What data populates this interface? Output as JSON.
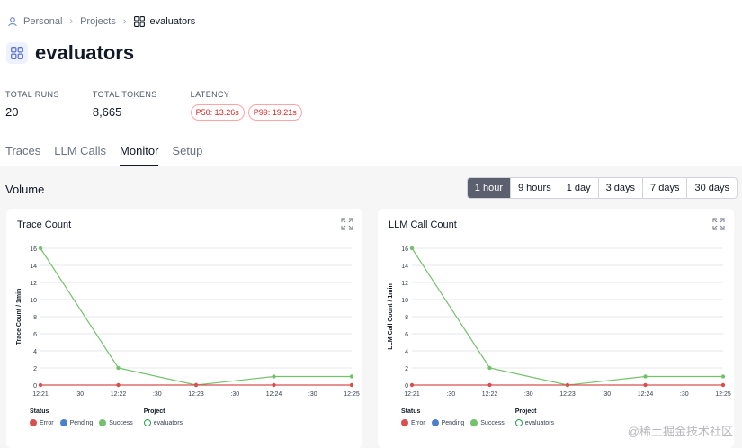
{
  "breadcrumb": {
    "personal": "Personal",
    "projects": "Projects",
    "current": "evaluators"
  },
  "page": {
    "title": "evaluators"
  },
  "stats": {
    "total_runs_label": "TOTAL RUNS",
    "total_runs": "20",
    "total_tokens_label": "TOTAL TOKENS",
    "total_tokens": "8,665",
    "latency_label": "LATENCY",
    "p50": "P50: 13.26s",
    "p99": "P99: 19.21s"
  },
  "tabs": [
    {
      "label": "Traces"
    },
    {
      "label": "LLM Calls"
    },
    {
      "label": "Monitor",
      "active": true
    },
    {
      "label": "Setup"
    }
  ],
  "monitor": {
    "volume_label": "Volume",
    "ranges": [
      "1 hour",
      "9 hours",
      "1 day",
      "3 days",
      "7 days",
      "30 days"
    ],
    "selected_range": "1 hour"
  },
  "colors": {
    "success": "#74c16b",
    "error": "#d94f4f",
    "pending": "#4c7fd0",
    "active_range": "#5c5f6e",
    "badge": "#dc2626"
  },
  "legend": {
    "status_label": "Status",
    "error": "Error",
    "pending": "Pending",
    "success": "Success",
    "project_label": "Project",
    "project": "evaluators"
  },
  "chart_data": [
    {
      "type": "line",
      "title": "Trace Count",
      "ylabel": "Trace Count / 1min",
      "xlabel": "",
      "ylim": [
        0,
        16
      ],
      "yticks": [
        0,
        2,
        4,
        6,
        8,
        10,
        12,
        14,
        16
      ],
      "xticks": [
        "12:21",
        ":30",
        "12:22",
        ":30",
        "12:23",
        ":30",
        "12:24",
        ":30",
        "12:25"
      ],
      "x": [
        "12:21",
        "12:22",
        "12:23",
        "12:24",
        "12:25"
      ],
      "series": [
        {
          "name": "Success",
          "values": [
            16,
            2,
            0,
            1,
            1
          ]
        },
        {
          "name": "Error",
          "values": [
            0,
            0,
            0,
            0,
            0
          ]
        }
      ],
      "grid": true,
      "legend": "bottom-left"
    },
    {
      "type": "line",
      "title": "LLM Call Count",
      "ylabel": "LLM Call Count / 1min",
      "xlabel": "",
      "ylim": [
        0,
        16
      ],
      "yticks": [
        0,
        2,
        4,
        6,
        8,
        10,
        12,
        14,
        16
      ],
      "xticks": [
        "12:21",
        ":30",
        "12:22",
        ":30",
        "12:23",
        ":30",
        "12:24",
        ":30",
        "12:25"
      ],
      "x": [
        "12:21",
        "12:22",
        "12:23",
        "12:24",
        "12:25"
      ],
      "series": [
        {
          "name": "Success",
          "values": [
            16,
            2,
            0,
            1,
            1
          ]
        },
        {
          "name": "Error",
          "values": [
            0,
            0,
            0,
            0,
            0
          ]
        }
      ],
      "grid": true,
      "legend": "bottom-left"
    }
  ],
  "watermark": "@稀土掘金技术社区"
}
